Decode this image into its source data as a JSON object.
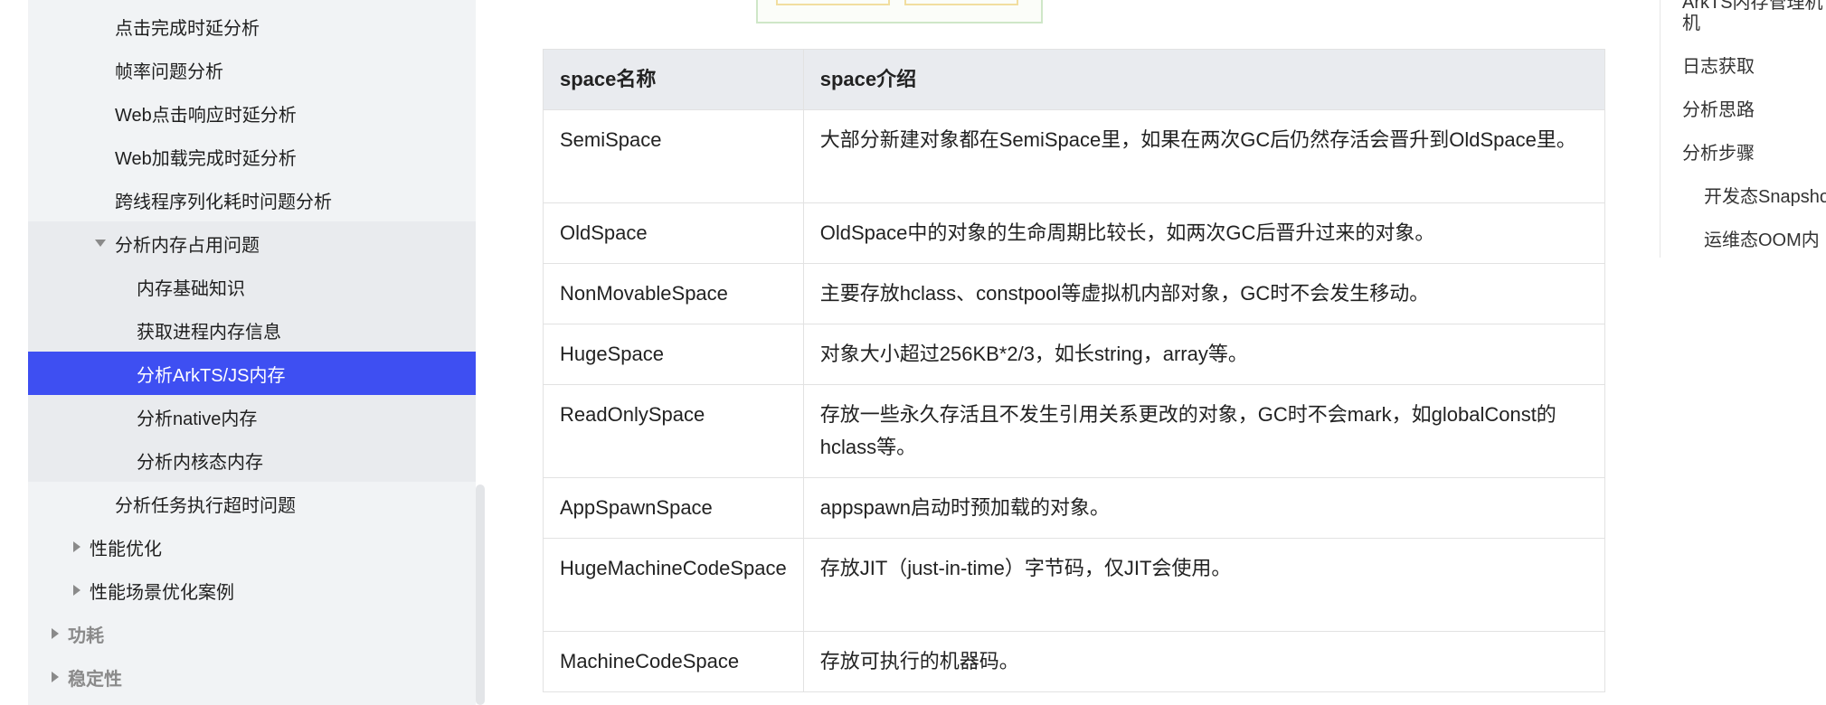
{
  "nav": {
    "items": [
      {
        "label": "点击完成时延分析",
        "level": 3
      },
      {
        "label": "帧率问题分析",
        "level": 3
      },
      {
        "label": "Web点击响应时延分析",
        "level": 3
      },
      {
        "label": "Web加载完成时延分析",
        "level": 3
      },
      {
        "label": "跨线程序列化耗时问题分析",
        "level": 3
      },
      {
        "label": "分析内存占用问题",
        "level": 3,
        "expanded": true
      },
      {
        "label": "内存基础知识",
        "level": 4
      },
      {
        "label": "获取进程内存信息",
        "level": 4
      },
      {
        "label": "分析ArkTS/JS内存",
        "level": 4,
        "active": true
      },
      {
        "label": "分析native内存",
        "level": 4
      },
      {
        "label": "分析内核态内存",
        "level": 4
      },
      {
        "label": "分析任务执行超时问题",
        "level": 3
      },
      {
        "label": "性能优化",
        "level": 2,
        "collapsed": true
      },
      {
        "label": "性能场景优化案例",
        "level": 2,
        "collapsed": true
      },
      {
        "label": "功耗",
        "level": 1,
        "collapsed": true
      },
      {
        "label": "稳定性",
        "level": 1,
        "collapsed": true
      }
    ]
  },
  "table": {
    "headers": [
      "space名称",
      "space介绍"
    ],
    "rows": [
      {
        "name": "SemiSpace",
        "desc": "大部分新建对象都在SemiSpace里，如果在两次GC后仍然存活会晋升到OldSpace里。"
      },
      {
        "name": "OldSpace",
        "desc": "OldSpace中的对象的生命周期比较长，如两次GC后晋升过来的对象。"
      },
      {
        "name": "NonMovableSpace",
        "desc": "主要存放hclass、constpool等虚拟机内部对象，GC时不会发生移动。"
      },
      {
        "name": "HugeSpace",
        "desc": "对象大小超过256KB*2/3，如长string，array等。"
      },
      {
        "name": "ReadOnlySpace",
        "desc": "存放一些永久存活且不发生引用关系更改的对象，GC时不会mark，如globalConst的hclass等。"
      },
      {
        "name": "AppSpawnSpace",
        "desc": "appspawn启动时预加载的对象。"
      },
      {
        "name": "HugeMachineCodeSpace",
        "desc": "存放JIT（just-in-time）字节码，仅JIT会使用。"
      },
      {
        "name": "MachineCodeSpace",
        "desc": "存放可执行的机器码。"
      }
    ]
  },
  "toc": {
    "items": [
      {
        "label": "ArkTS内存管理机",
        "indent": true,
        "partial_top": true
      },
      {
        "label": "机",
        "indent": true
      },
      {
        "label": "日志获取",
        "indent": false
      },
      {
        "label": "分析思路",
        "indent": false
      },
      {
        "label": "分析步骤",
        "indent": false
      },
      {
        "label": "开发态Snapshot",
        "indent": true
      },
      {
        "label": "运维态OOM内",
        "indent": true
      }
    ]
  }
}
